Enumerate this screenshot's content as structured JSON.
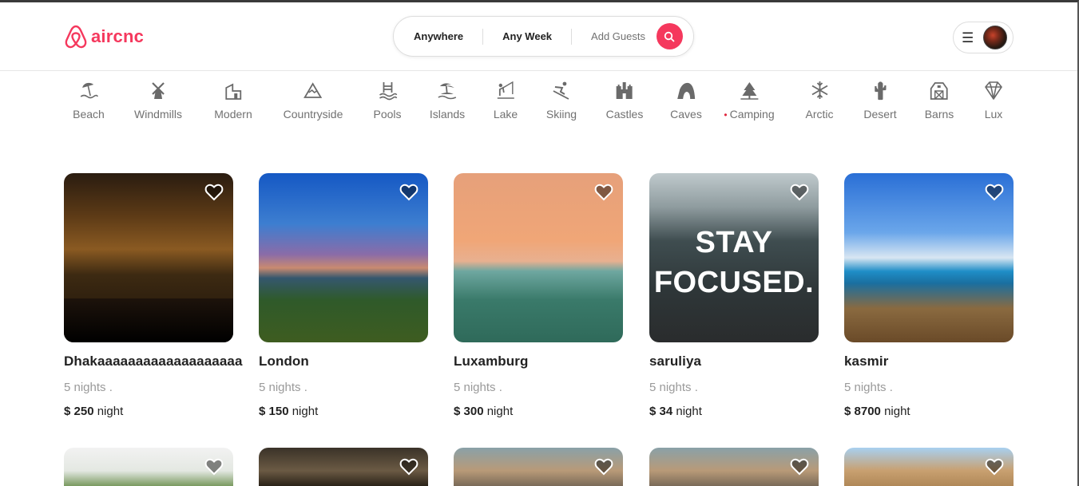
{
  "brand": {
    "name": "aircnc",
    "color": "#f5385d"
  },
  "search": {
    "where": "Anywhere",
    "when": "Any Week",
    "guests": "Add Guests"
  },
  "categories": [
    {
      "label": "Beach",
      "icon": "beach-umbrella-icon"
    },
    {
      "label": "Windmills",
      "icon": "windmill-icon"
    },
    {
      "label": "Modern",
      "icon": "modern-house-icon"
    },
    {
      "label": "Countryside",
      "icon": "mountain-icon"
    },
    {
      "label": "Pools",
      "icon": "pool-icon"
    },
    {
      "label": "Islands",
      "icon": "island-icon"
    },
    {
      "label": "Lake",
      "icon": "fishing-icon"
    },
    {
      "label": "Skiing",
      "icon": "skier-icon"
    },
    {
      "label": "Castles",
      "icon": "castle-icon"
    },
    {
      "label": "Caves",
      "icon": "cave-icon"
    },
    {
      "label": "Camping",
      "icon": "tent-icon",
      "active": true
    },
    {
      "label": "Arctic",
      "icon": "snowflake-icon"
    },
    {
      "label": "Desert",
      "icon": "cactus-icon"
    },
    {
      "label": "Barns",
      "icon": "barn-icon"
    },
    {
      "label": "Lux",
      "icon": "diamond-icon"
    }
  ],
  "listings": [
    {
      "title": "Dhakaaaaaaaaaaaaaaaaaaa",
      "nights": "5 nights .",
      "price": "$ 250",
      "unit": "night"
    },
    {
      "title": "London",
      "nights": "5 nights .",
      "price": "$ 150",
      "unit": "night"
    },
    {
      "title": "Luxamburg",
      "nights": "5 nights .",
      "price": "$ 300",
      "unit": "night"
    },
    {
      "title": "saruliya",
      "nights": "5 nights .",
      "price": "$ 34",
      "unit": "night",
      "image_text": "STAY FOCUSED."
    },
    {
      "title": "kasmir",
      "nights": "5 nights .",
      "price": "$ 8700",
      "unit": "night"
    }
  ]
}
